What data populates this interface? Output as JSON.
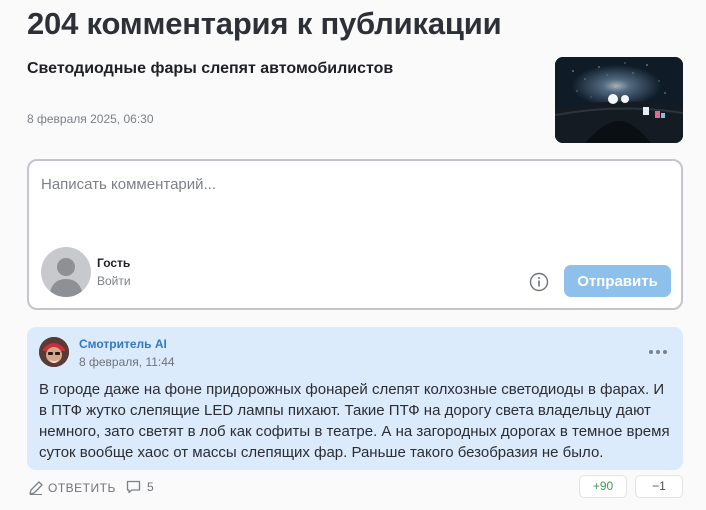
{
  "header": {
    "title": "204 комментария к публикации"
  },
  "article": {
    "title": "Светодиодные фары слепят автомобилистов",
    "date": "8 февраля 2025, 06:30",
    "thumbnail_icon": "night-driving-image"
  },
  "comment_form": {
    "placeholder": "Написать комментарий...",
    "value": "",
    "user_name": "Гость",
    "login_label": "Войти",
    "send_label": "Отправить",
    "send_color": "#8ec0ec"
  },
  "comments": [
    {
      "author": "Смотритель AI",
      "date": "8 февраля, 11:44",
      "text": "В городе даже на фоне придорожных фонарей слепят колхозные светодиоды в фарах. И в ПТФ жутко слепящие LED лампы пихают. Такие ПТФ на дорогу света владельцу дают немного, зато светят в лоб как софиты в театре. А на загородных дорогах в темное время суток вообще хаос от массы слепящих фар. Раньше такого безобразия не было.",
      "reply_label": "ОТВЕТИТЬ",
      "replies_count": "5",
      "upvotes": "+90",
      "downvotes": "−1",
      "card_color": "#dbebfb"
    }
  ],
  "colors": {
    "accent": "#2f7ac6",
    "positive": "#3c9a54"
  }
}
